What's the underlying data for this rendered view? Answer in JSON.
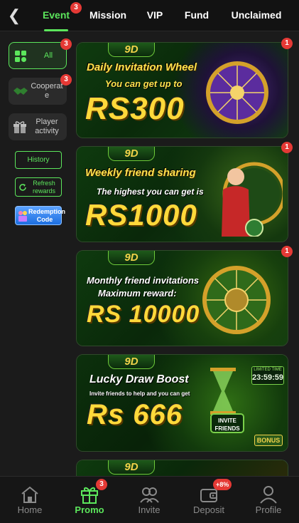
{
  "header": {
    "tabs": [
      {
        "label": "Event",
        "badge": "3"
      },
      {
        "label": "Mission"
      },
      {
        "label": "VIP"
      },
      {
        "label": "Fund"
      },
      {
        "label": "Unclaimed"
      }
    ]
  },
  "sidebar": {
    "items": [
      {
        "label": "All",
        "badge": "3"
      },
      {
        "label": "Cooperate",
        "badge": "3"
      },
      {
        "label": "Player activity"
      }
    ],
    "history_label": "History",
    "refresh_label": "Refresh rewards",
    "redeem_label": "Redemption Code"
  },
  "banners": [
    {
      "logo": "9D",
      "title": "Daily Invitation Wheel",
      "subtitle": "You can get up to",
      "amount": "RS300",
      "badge": "1"
    },
    {
      "logo": "9D",
      "title": "Weekly friend sharing",
      "subtitle": "The highest you can get is",
      "amount": "RS1000",
      "badge": "1"
    },
    {
      "logo": "9D",
      "title": "Monthly friend invitations",
      "subtitle": "Maximum reward:",
      "amount": "RS 10000",
      "badge": "1"
    },
    {
      "logo": "9D",
      "title": "Lucky Draw Boost",
      "subtitle": "Invite friends to help and you can get",
      "amount": "Rs 666",
      "badge": "",
      "cta": "INVITE FRIENDS",
      "timer": "23:59:59",
      "timer_label": "LIMITED TIME",
      "extra": "BONUS"
    },
    {
      "logo": "9D"
    }
  ],
  "bottom_nav": {
    "items": [
      {
        "label": "Home"
      },
      {
        "label": "Promo",
        "badge": "3"
      },
      {
        "label": "Invite"
      },
      {
        "label": "Deposit",
        "badge": "+8%"
      },
      {
        "label": "Profile"
      }
    ]
  },
  "colors": {
    "accent": "#5ce65c",
    "badge": "#e53935",
    "gold": "#ffd93a"
  }
}
